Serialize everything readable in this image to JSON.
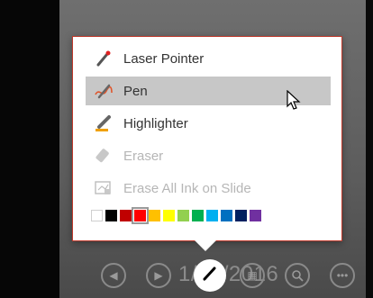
{
  "menu": {
    "items": [
      {
        "label": "Laser Pointer",
        "icon": "laser-pointer-icon",
        "state": "normal"
      },
      {
        "label": "Pen",
        "icon": "pen-icon",
        "state": "hover"
      },
      {
        "label": "Highlighter",
        "icon": "highlighter-icon",
        "state": "normal"
      },
      {
        "label": "Eraser",
        "icon": "eraser-icon",
        "state": "disabled"
      },
      {
        "label": "Erase All Ink on Slide",
        "icon": "erase-all-icon",
        "state": "disabled"
      }
    ],
    "colors": [
      "#ffffff",
      "#000000",
      "#c00000",
      "#ff0000",
      "#ffc000",
      "#ffff00",
      "#92d050",
      "#00b050",
      "#00b0f0",
      "#0070c0",
      "#002060",
      "#7030a0"
    ],
    "selected_color": "#ff0000",
    "accent_border": "#c0392b"
  },
  "toolbar": {
    "buttons": [
      "previous-icon",
      "next-icon",
      "pen-icon",
      "see-all-slides-icon",
      "zoom-icon",
      "more-options-icon"
    ],
    "date_text": "1/25/2016"
  }
}
